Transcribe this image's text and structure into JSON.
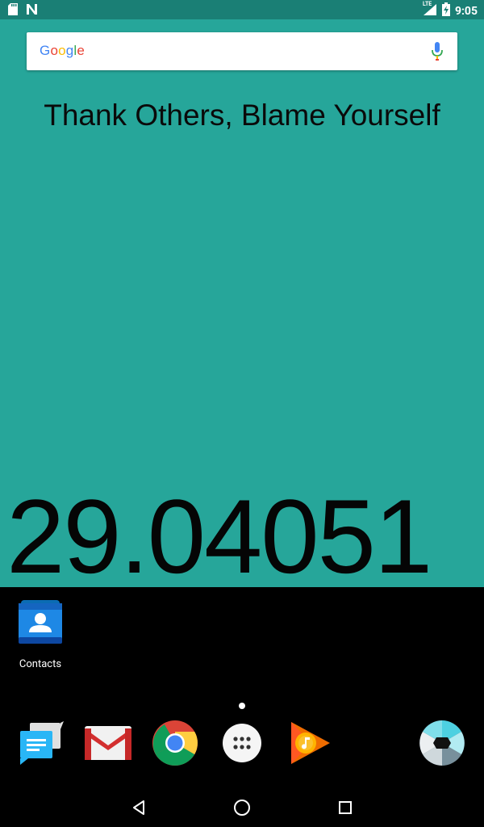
{
  "status_bar": {
    "time": "9:05",
    "network": "LTE",
    "icons": [
      "sd-card-icon",
      "n-notification-icon",
      "signal-icon",
      "battery-charging-icon"
    ]
  },
  "search_bar": {
    "logo": "Google",
    "icons": [
      "mic-icon"
    ]
  },
  "widget": {
    "quote": "Thank Others, Blame Yourself",
    "counter": "29.04051"
  },
  "desktop": {
    "apps": [
      {
        "label": "Contacts",
        "icon": "contacts-icon"
      }
    ]
  },
  "dock": {
    "apps": [
      "messenger-icon",
      "gmail-icon",
      "chrome-icon",
      "app-drawer-icon",
      "play-music-icon",
      "camera-icon"
    ]
  },
  "nav_bar": {
    "icons": [
      "back-icon",
      "home-icon",
      "recents-icon"
    ]
  },
  "colors": {
    "wallpaper": "#26a69a",
    "status_bar": "#1a7f75",
    "background": "#000000"
  }
}
